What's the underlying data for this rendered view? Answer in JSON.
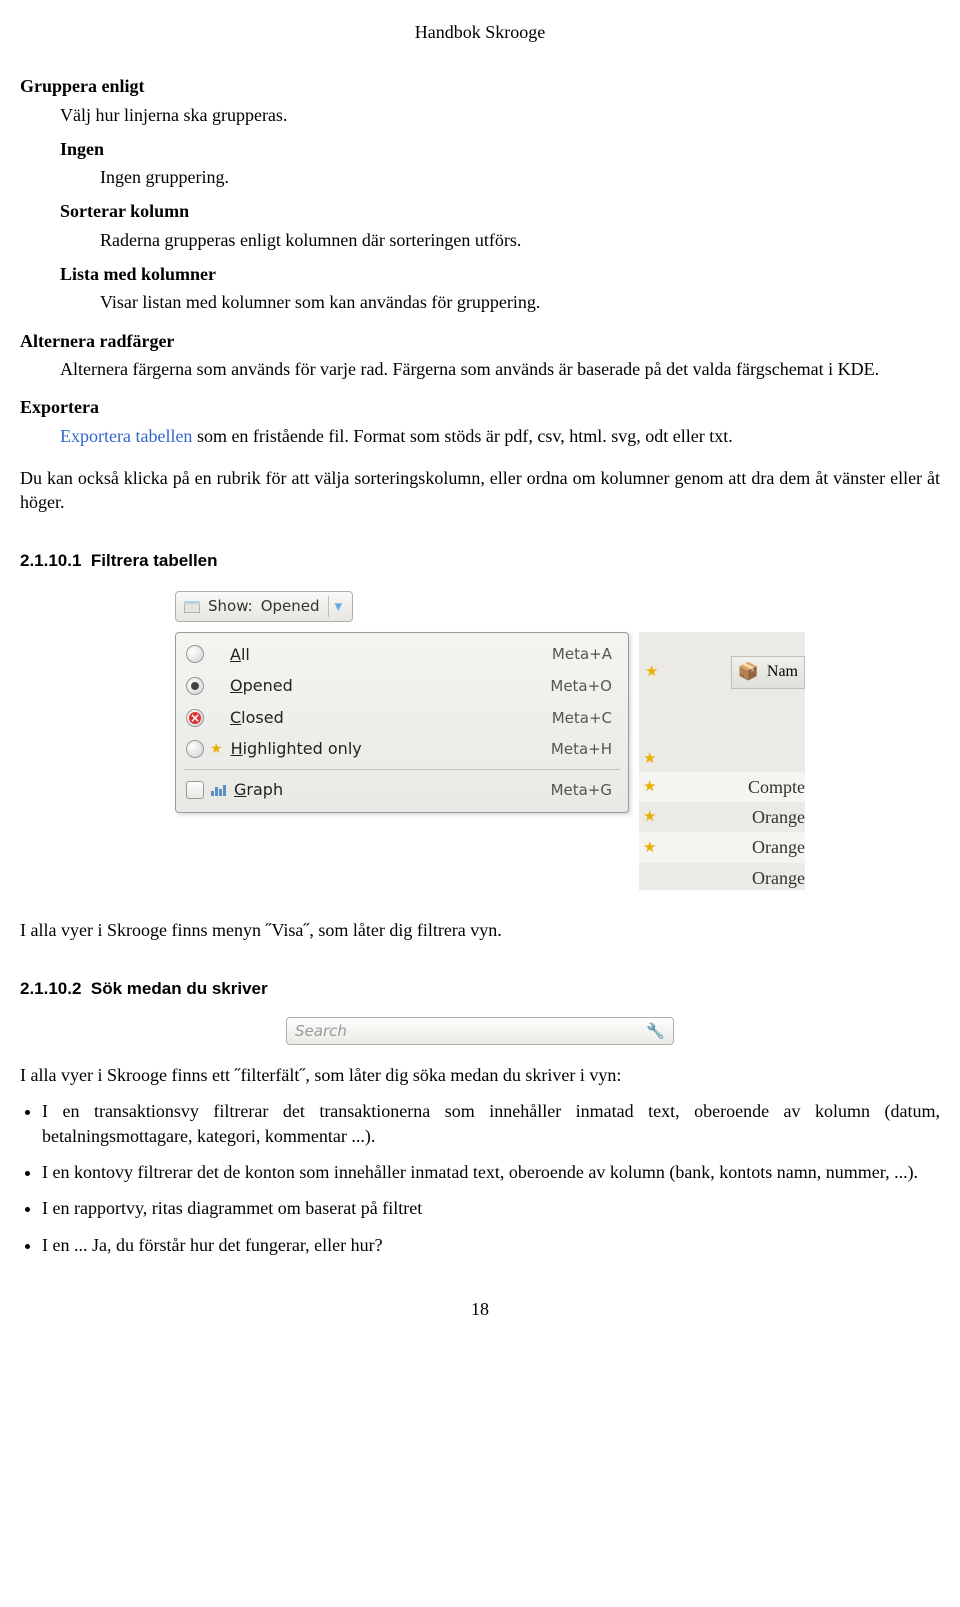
{
  "header": {
    "title": "Handbok Skrooge"
  },
  "defs": {
    "gruppera": {
      "term": "Gruppera enligt",
      "desc": "Välj hur linjerna ska grupperas.",
      "ingen": {
        "term": "Ingen",
        "desc": "Ingen gruppering."
      },
      "sorterar": {
        "term": "Sorterar kolumn",
        "desc": "Raderna grupperas enligt kolumnen där sorteringen utförs."
      },
      "lista": {
        "term": "Lista med kolumner",
        "desc": "Visar listan med kolumner som kan användas för gruppering."
      }
    },
    "alternera": {
      "term": "Alternera radfärger",
      "desc": "Alternera färgerna som används för varje rad. Färgerna som används är baserade på det valda färgschemat i KDE."
    },
    "exportera": {
      "term": "Exportera",
      "link": "Exportera tabellen",
      "desc": " som en fristående fil. Format som stöds är pdf, csv, html. svg, odt eller txt."
    }
  },
  "para_rubrik": "Du kan också klicka på en rubrik för att välja sorteringskolumn, eller ordna om kolumner genom att dra dem åt vänster eller åt höger.",
  "sections": {
    "filter": {
      "num": "2.1.10.1",
      "title": "Filtrera tabellen"
    },
    "search": {
      "num": "2.1.10.2",
      "title": "Sök medan du skriver"
    }
  },
  "dropdown": {
    "show_label_prefix": "Show:",
    "show_value": "Opened",
    "menu": {
      "all_label": "All",
      "all_key": "A",
      "all_shortcut": "Meta+A",
      "opened_label": "Opened",
      "opened_key": "O",
      "opened_shortcut": "Meta+O",
      "closed_label": "Closed",
      "closed_key": "C",
      "closed_shortcut": "Meta+C",
      "highlighted_label": "Highlighted only",
      "highlighted_key": "H",
      "highlighted_shortcut": "Meta+H",
      "graph_label": "Graph",
      "graph_key": "G",
      "graph_shortcut": "Meta+G"
    },
    "right": {
      "col": "Nam",
      "rows": [
        "Compte",
        "Orange",
        "Orange",
        "Orange"
      ]
    }
  },
  "para_filter": "I alla vyer i Skrooge finns menyn ˝Visa˝, som låter dig filtrera vyn.",
  "search": {
    "placeholder": "Search"
  },
  "para_search_intro": "I alla vyer i Skrooge finns ett ˝filterfält˝, som låter dig söka medan du skriver i vyn:",
  "bullets": {
    "b1": "I en transaktionsvy filtrerar det transaktionerna som innehåller inmatad text, oberoende av kolumn (datum, betalningsmottagare, kategori, kommentar ...).",
    "b2": "I en kontovy filtrerar det de konton som innehåller inmatad text, oberoende av kolumn (bank, kontots namn, nummer, ...).",
    "b3": "I en rapportvy, ritas diagrammet om baserat på filtret",
    "b4": "I en ... Ja, du förstår hur det fungerar, eller hur?"
  },
  "page_number": "18"
}
